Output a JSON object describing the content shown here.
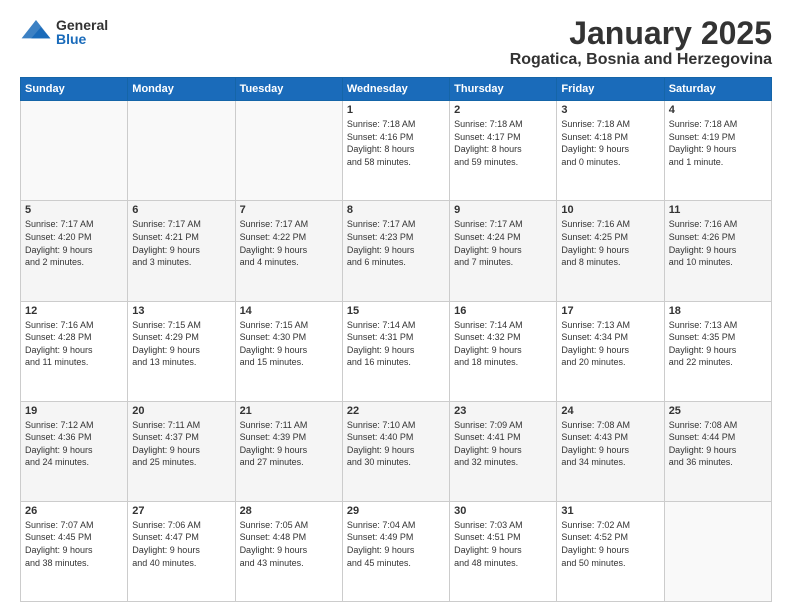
{
  "header": {
    "logo_general": "General",
    "logo_blue": "Blue",
    "title": "January 2025",
    "subtitle": "Rogatica, Bosnia and Herzegovina"
  },
  "weekdays": [
    "Sunday",
    "Monday",
    "Tuesday",
    "Wednesday",
    "Thursday",
    "Friday",
    "Saturday"
  ],
  "weeks": [
    [
      {
        "day": "",
        "info": ""
      },
      {
        "day": "",
        "info": ""
      },
      {
        "day": "",
        "info": ""
      },
      {
        "day": "1",
        "info": "Sunrise: 7:18 AM\nSunset: 4:16 PM\nDaylight: 8 hours\nand 58 minutes."
      },
      {
        "day": "2",
        "info": "Sunrise: 7:18 AM\nSunset: 4:17 PM\nDaylight: 8 hours\nand 59 minutes."
      },
      {
        "day": "3",
        "info": "Sunrise: 7:18 AM\nSunset: 4:18 PM\nDaylight: 9 hours\nand 0 minutes."
      },
      {
        "day": "4",
        "info": "Sunrise: 7:18 AM\nSunset: 4:19 PM\nDaylight: 9 hours\nand 1 minute."
      }
    ],
    [
      {
        "day": "5",
        "info": "Sunrise: 7:17 AM\nSunset: 4:20 PM\nDaylight: 9 hours\nand 2 minutes."
      },
      {
        "day": "6",
        "info": "Sunrise: 7:17 AM\nSunset: 4:21 PM\nDaylight: 9 hours\nand 3 minutes."
      },
      {
        "day": "7",
        "info": "Sunrise: 7:17 AM\nSunset: 4:22 PM\nDaylight: 9 hours\nand 4 minutes."
      },
      {
        "day": "8",
        "info": "Sunrise: 7:17 AM\nSunset: 4:23 PM\nDaylight: 9 hours\nand 6 minutes."
      },
      {
        "day": "9",
        "info": "Sunrise: 7:17 AM\nSunset: 4:24 PM\nDaylight: 9 hours\nand 7 minutes."
      },
      {
        "day": "10",
        "info": "Sunrise: 7:16 AM\nSunset: 4:25 PM\nDaylight: 9 hours\nand 8 minutes."
      },
      {
        "day": "11",
        "info": "Sunrise: 7:16 AM\nSunset: 4:26 PM\nDaylight: 9 hours\nand 10 minutes."
      }
    ],
    [
      {
        "day": "12",
        "info": "Sunrise: 7:16 AM\nSunset: 4:28 PM\nDaylight: 9 hours\nand 11 minutes."
      },
      {
        "day": "13",
        "info": "Sunrise: 7:15 AM\nSunset: 4:29 PM\nDaylight: 9 hours\nand 13 minutes."
      },
      {
        "day": "14",
        "info": "Sunrise: 7:15 AM\nSunset: 4:30 PM\nDaylight: 9 hours\nand 15 minutes."
      },
      {
        "day": "15",
        "info": "Sunrise: 7:14 AM\nSunset: 4:31 PM\nDaylight: 9 hours\nand 16 minutes."
      },
      {
        "day": "16",
        "info": "Sunrise: 7:14 AM\nSunset: 4:32 PM\nDaylight: 9 hours\nand 18 minutes."
      },
      {
        "day": "17",
        "info": "Sunrise: 7:13 AM\nSunset: 4:34 PM\nDaylight: 9 hours\nand 20 minutes."
      },
      {
        "day": "18",
        "info": "Sunrise: 7:13 AM\nSunset: 4:35 PM\nDaylight: 9 hours\nand 22 minutes."
      }
    ],
    [
      {
        "day": "19",
        "info": "Sunrise: 7:12 AM\nSunset: 4:36 PM\nDaylight: 9 hours\nand 24 minutes."
      },
      {
        "day": "20",
        "info": "Sunrise: 7:11 AM\nSunset: 4:37 PM\nDaylight: 9 hours\nand 25 minutes."
      },
      {
        "day": "21",
        "info": "Sunrise: 7:11 AM\nSunset: 4:39 PM\nDaylight: 9 hours\nand 27 minutes."
      },
      {
        "day": "22",
        "info": "Sunrise: 7:10 AM\nSunset: 4:40 PM\nDaylight: 9 hours\nand 30 minutes."
      },
      {
        "day": "23",
        "info": "Sunrise: 7:09 AM\nSunset: 4:41 PM\nDaylight: 9 hours\nand 32 minutes."
      },
      {
        "day": "24",
        "info": "Sunrise: 7:08 AM\nSunset: 4:43 PM\nDaylight: 9 hours\nand 34 minutes."
      },
      {
        "day": "25",
        "info": "Sunrise: 7:08 AM\nSunset: 4:44 PM\nDaylight: 9 hours\nand 36 minutes."
      }
    ],
    [
      {
        "day": "26",
        "info": "Sunrise: 7:07 AM\nSunset: 4:45 PM\nDaylight: 9 hours\nand 38 minutes."
      },
      {
        "day": "27",
        "info": "Sunrise: 7:06 AM\nSunset: 4:47 PM\nDaylight: 9 hours\nand 40 minutes."
      },
      {
        "day": "28",
        "info": "Sunrise: 7:05 AM\nSunset: 4:48 PM\nDaylight: 9 hours\nand 43 minutes."
      },
      {
        "day": "29",
        "info": "Sunrise: 7:04 AM\nSunset: 4:49 PM\nDaylight: 9 hours\nand 45 minutes."
      },
      {
        "day": "30",
        "info": "Sunrise: 7:03 AM\nSunset: 4:51 PM\nDaylight: 9 hours\nand 48 minutes."
      },
      {
        "day": "31",
        "info": "Sunrise: 7:02 AM\nSunset: 4:52 PM\nDaylight: 9 hours\nand 50 minutes."
      },
      {
        "day": "",
        "info": ""
      }
    ]
  ]
}
